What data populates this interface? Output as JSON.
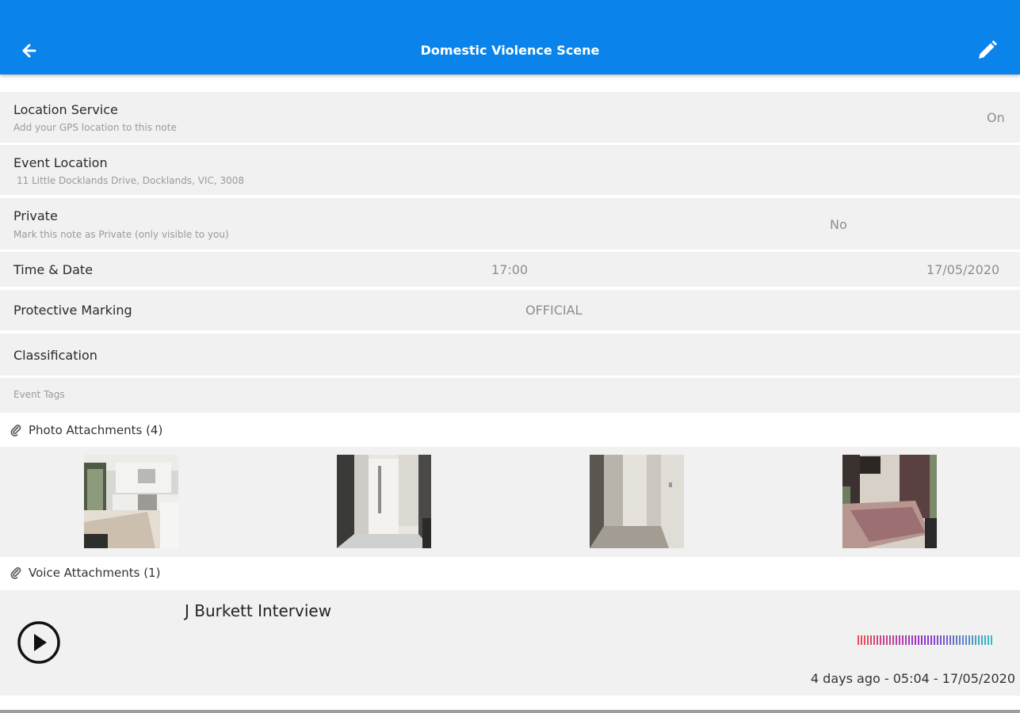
{
  "header": {
    "title": "Domestic Violence Scene",
    "back_icon": "arrow-left-icon",
    "edit_icon": "pencil-icon",
    "color": "#0a84ea"
  },
  "rows": {
    "location_service": {
      "label": "Location Service",
      "sub": "Add your GPS location to this note",
      "value": "On"
    },
    "event_location": {
      "label": "Event Location",
      "sub": "11 Little Docklands Drive, Docklands, VIC, 3008"
    },
    "private": {
      "label": "Private",
      "sub": "Mark this note as Private (only visible to you)",
      "value": "No"
    },
    "time_date": {
      "label": "Time & Date",
      "time": "17:00",
      "date": "17/05/2020"
    },
    "protective_marking": {
      "label": "Protective Marking",
      "value": "OFFICIAL"
    },
    "classification": {
      "label": "Classification"
    },
    "event_tags": {
      "placeholder": "Event Tags"
    }
  },
  "photo_attachments": {
    "heading": "Photo Attachments (4)",
    "icon": "paperclip-icon",
    "photos": [
      {
        "name": "kitchen-photo"
      },
      {
        "name": "hallway-door-photo"
      },
      {
        "name": "corridor-photo"
      },
      {
        "name": "bedroom-photo"
      }
    ]
  },
  "voice_attachments": {
    "heading": "Voice Attachments (1)",
    "icon": "paperclip-icon",
    "items": [
      {
        "title": "J Burkett Interview",
        "timestamp": "4 days ago - 05:04 - 17/05/2020",
        "play_icon": "play-circle-icon",
        "waveform_icon": "waveform-icon"
      }
    ]
  }
}
